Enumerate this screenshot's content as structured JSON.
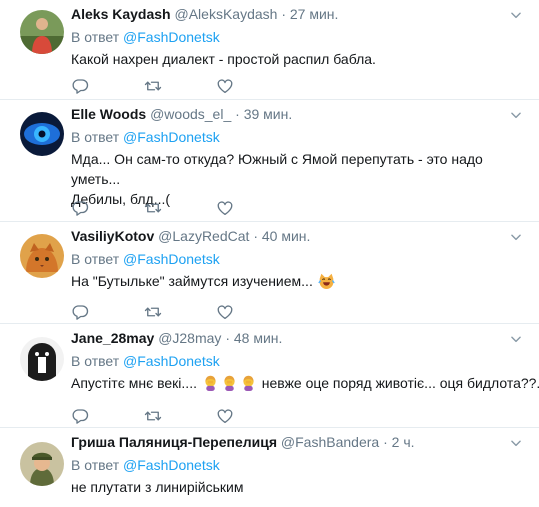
{
  "tweets": [
    {
      "name": "Aleks Kaydash",
      "handle": "@AleksKaydash",
      "time": "· 27 мин.",
      "reply_prefix": "В ответ",
      "reply_to": "@FashDonetsk",
      "text": "Какой нахрен диалект - простой распил бабла.",
      "avatar_icon": "person-forest-avatar"
    },
    {
      "name": "Elle Woods",
      "handle": "@woods_el_",
      "time": "· 39 мин.",
      "reply_prefix": "В ответ",
      "reply_to": "@FashDonetsk",
      "text_line1": "Мда... Он сам-то откуда? Южный с Ямой перепутать - это надо уметь...",
      "text_line2": "Дебилы, блд...(",
      "avatar_icon": "blue-eye-avatar"
    },
    {
      "name": "VasiliyKotov",
      "handle": "@LazyRedCat",
      "time": "· 40 мин.",
      "reply_prefix": "В ответ",
      "reply_to": "@FashDonetsk",
      "text": "На \"Бутыльке\" займутся изучением...",
      "emoji": "laughing-crying-cat-emoji",
      "avatar_icon": "red-cat-avatar"
    },
    {
      "name": "Jane_28may",
      "handle": "@J28may",
      "time": "· 48 мин.",
      "reply_prefix": "В ответ",
      "reply_to": "@FashDonetsk",
      "text_a": "Апустітє мнє векі....",
      "text_b": "невже оце поряд животіє... оця бидлота??...",
      "emoji": "woman-facepalming-emoji",
      "avatar_icon": "black-white-dog-avatar"
    },
    {
      "name": "Гриша Паляниця-Перепелиця",
      "handle": "@FashBandera",
      "time": "· 2 ч.",
      "reply_prefix": "В ответ",
      "reply_to": "@FashDonetsk",
      "text": "не плутати з линирійським",
      "avatar_icon": "soldier-cartoon-avatar"
    }
  ],
  "icons": {
    "reply": "reply-icon",
    "retweet": "retweet-icon",
    "like": "heart-icon",
    "menu": "chevron-down-icon"
  },
  "colors": {
    "link": "#1da1f2",
    "meta": "#657786",
    "text": "#14171a",
    "divider": "#e6ecf0"
  }
}
